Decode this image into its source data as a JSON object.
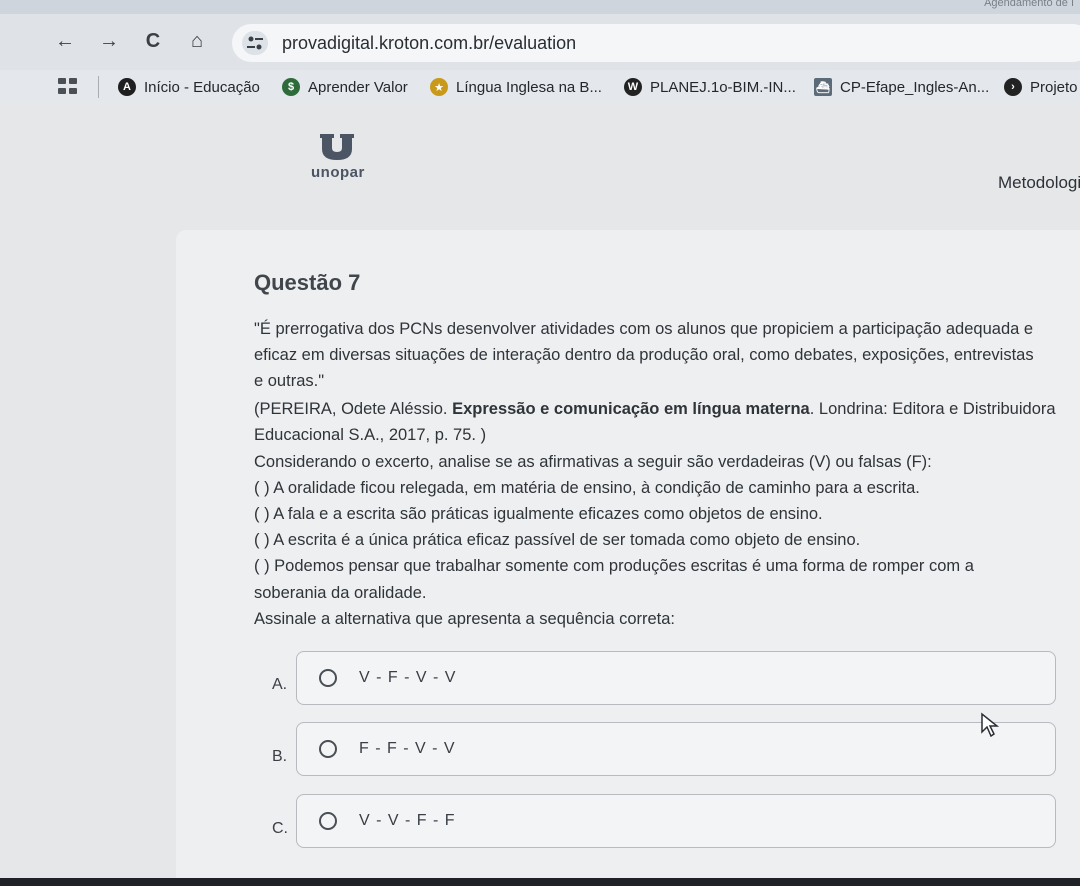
{
  "browser": {
    "tab_title_fragment": "Agendamento de I",
    "url": "provadigital.kroton.com.br/evaluation",
    "nav": {
      "back": "←",
      "forward": "→",
      "reload": "C",
      "home": "⌂"
    }
  },
  "bookmarks": [
    {
      "label": "Início - Educação",
      "icon": "education-icon",
      "color": "#1f1f1f"
    },
    {
      "label": "Aprender Valor",
      "icon": "piggy-bank-icon",
      "color": "#2e6b3a"
    },
    {
      "label": "Língua Inglesa na B...",
      "icon": "star-figure-icon",
      "color": "#c99a1a"
    },
    {
      "label": "PLANEJ.1o-BIM.-IN...",
      "icon": "wordpress-icon",
      "color": "#222222"
    },
    {
      "label": "CP-Efape_Ingles-An...",
      "icon": "ship-icon",
      "color": "#5b6b7a"
    },
    {
      "label": "Projeto",
      "icon": "badge-icon",
      "color": "#222222"
    }
  ],
  "header": {
    "logo_text": "unopar",
    "course_title": "Metodologi"
  },
  "question": {
    "title": "Questão 7",
    "lines": [
      "\"É prerrogativa dos PCNs desenvolver atividades com os alunos que propiciem a participação adequada e",
      "eficaz em diversas situações de interação dentro da produção oral, como debates, exposições, entrevistas",
      "e outras.\""
    ],
    "citation_prefix": "(PEREIRA, Odete Aléssio. ",
    "citation_bold": "Expressão e comunicação em língua materna",
    "citation_suffix": ". Londrina: Editora e Distribuidora",
    "citation_line2": "Educacional S.A., 2017, p. 75. )",
    "instruction": "Considerando o excerto, analise se as afirmativas a seguir são verdadeiras (V) ou falsas (F):",
    "statements": [
      "(  ) A oralidade ficou relegada, em matéria de ensino, à condição de caminho para a escrita.",
      "(  ) A fala e a escrita são práticas igualmente eficazes como objetos de ensino.",
      "(  ) A escrita é a única prática eficaz passível de ser tomada como objeto de ensino.",
      "(  ) Podemos pensar que trabalhar somente com produções escritas é uma forma de romper com a"
    ],
    "statement_continuation": "soberania da oralidade.",
    "prompt": "Assinale a alternativa que apresenta a sequência correta:"
  },
  "options": [
    {
      "letter": "A.",
      "text": "V - F - V - V"
    },
    {
      "letter": "B.",
      "text": "F - F - V - V"
    },
    {
      "letter": "C.",
      "text": "V - V - F - F"
    }
  ]
}
